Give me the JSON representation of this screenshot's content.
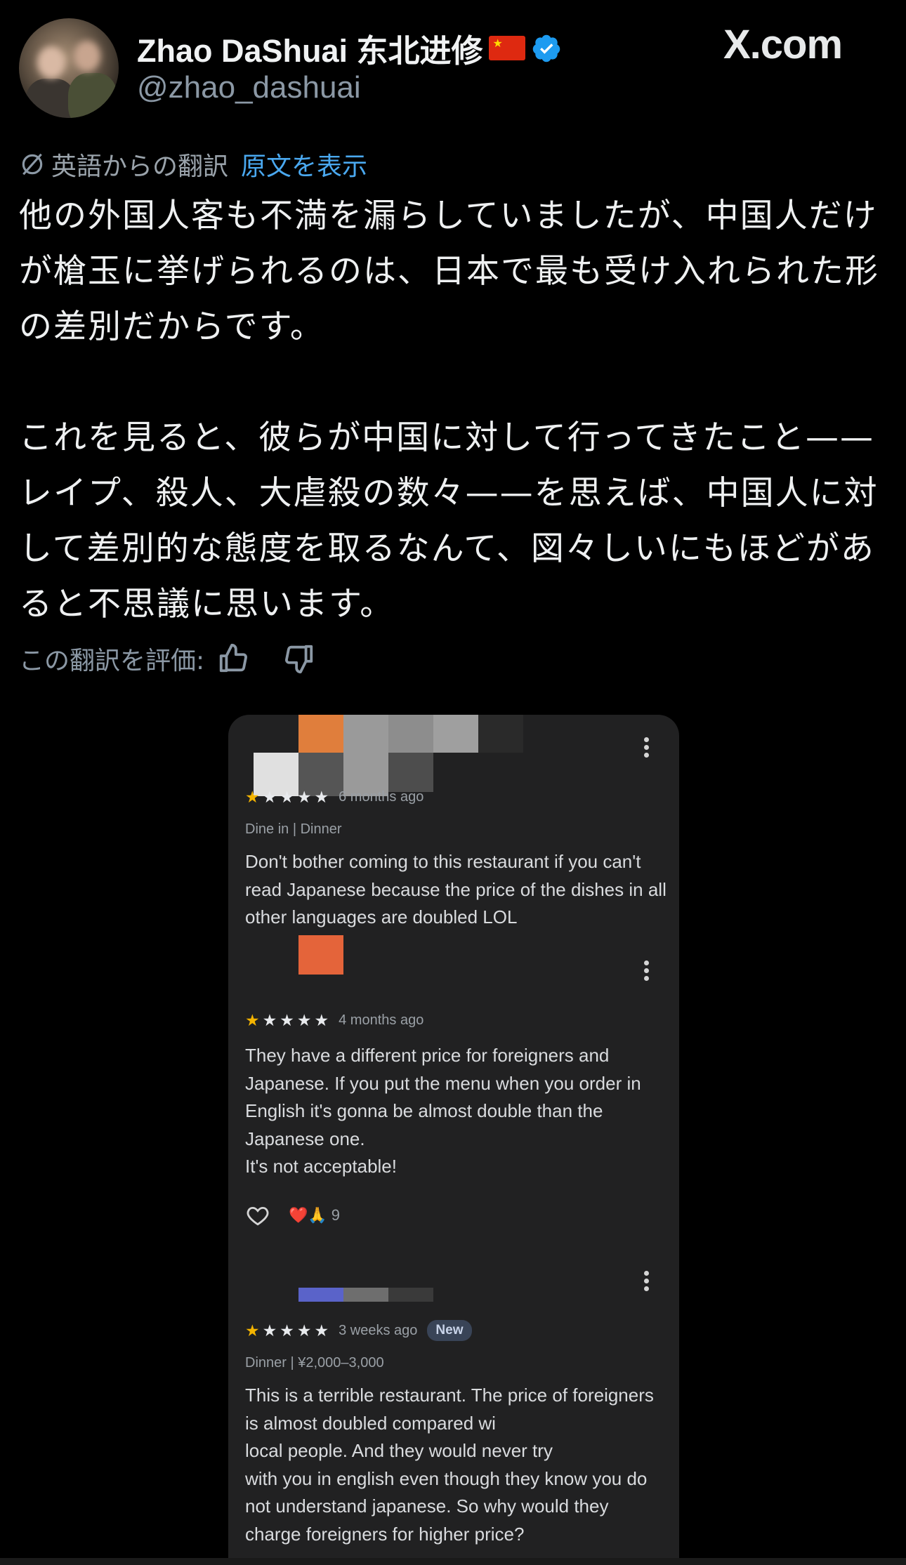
{
  "post": {
    "author_name": "Zhao DaShuai 东北进修",
    "handle": "@zhao_dashuai",
    "site": "X.com",
    "translation_label": "英語からの翻訳",
    "show_original_label": "原文を表示",
    "body": "他の外国人客も不満を漏らしていましたが、中国人だけが槍玉に挙げられるのは、日本で最も受け入れられた形の差別だからです。\n\nこれを見ると、彼らが中国に対して行ってきたこと——レイプ、殺人、大虐殺の数々——を思えば、中国人に対して差別的な態度を取るなんて、図々しいにもほどがあると不思議に思います。",
    "rate_label": "この翻訳を評価:"
  },
  "reviews": [
    {
      "time": "6 months ago",
      "stars": 1,
      "meta": "Dine in  |  Dinner",
      "text": "Don't bother coming to this restaurant if you can't read Japanese because the price of the dishes in all other languages are doubled LOL"
    },
    {
      "time": "4 months ago",
      "stars": 1,
      "text": "They have a different price for foreigners and Japanese. If you put the menu when you order in English it's gonna be almost double than the Japanese one.\nIt's not acceptable!",
      "reaction_count": "9",
      "reaction_emojis": "❤️🙏"
    },
    {
      "time": "3 weeks ago",
      "stars": 1,
      "badge": "New",
      "meta": "Dinner  |  ¥2,000–3,000",
      "text": "This is a terrible restaurant. The price of foreigners is almost doubled compared wi\nlocal people. And they would never try\nwith you in english even though they know you do not understand japanese. So why would they charge foreigners for higher price?"
    }
  ],
  "colors": {
    "background": "#000000",
    "link": "#4aa8ef",
    "verified": "#1d9bf0",
    "card": "#212122",
    "star_gold": "#f4b400",
    "badge_bg": "#394457"
  },
  "icons": [
    "verified-badge-icon",
    "translate-icon",
    "thumbs-up-icon",
    "thumbs-down-icon",
    "more-options-icon",
    "heart-icon"
  ]
}
